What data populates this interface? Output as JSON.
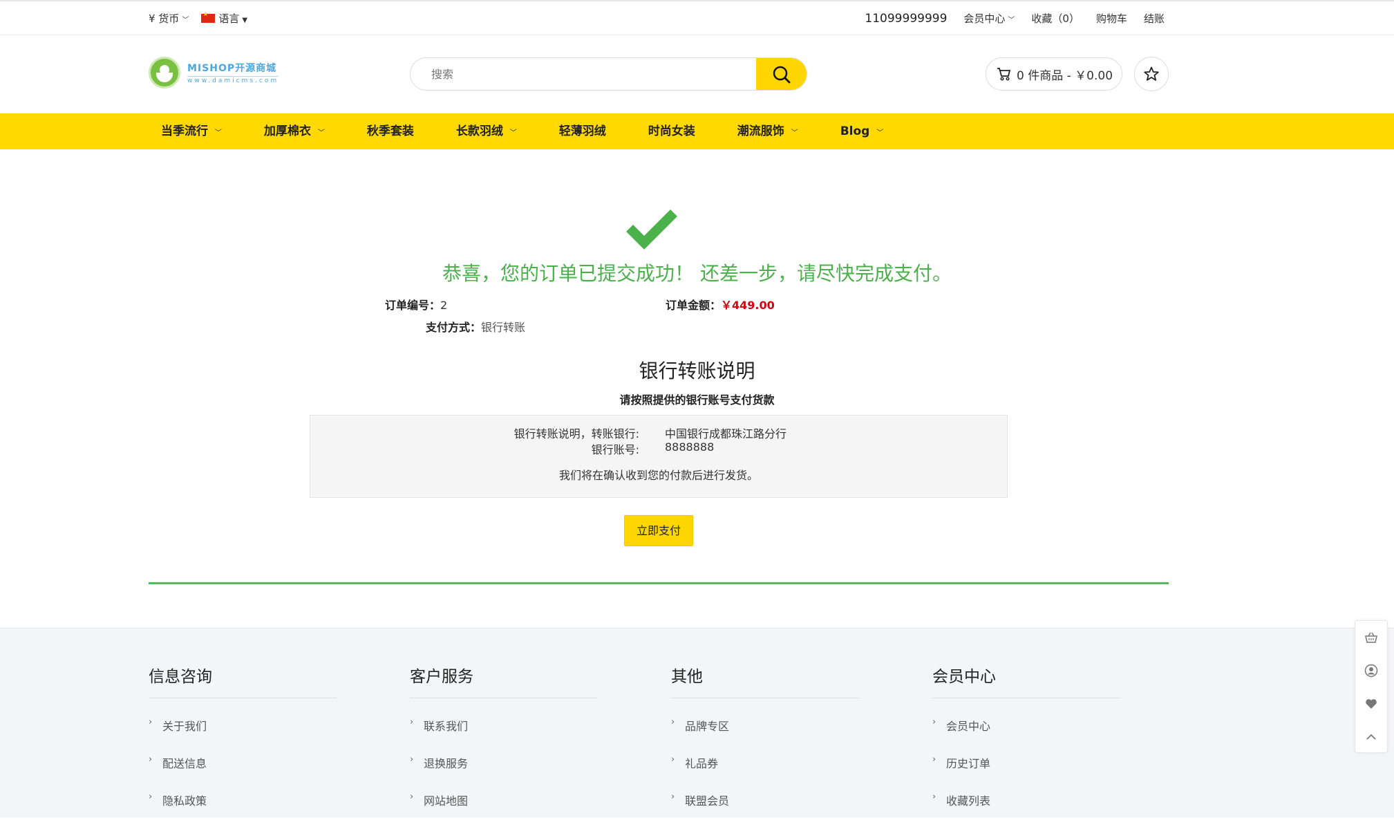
{
  "topbar": {
    "currency_label": "¥ 货币",
    "language_label": "语言",
    "phone": "11099999999",
    "member_center": "会员中心",
    "favorites": "收藏（0）",
    "cart": "购物车",
    "checkout": "结账"
  },
  "header": {
    "logo_line1": "MISHOP开源商城",
    "logo_line2": "www.damicms.com",
    "search_placeholder": "搜索",
    "cart_summary": "0 件商品 - ￥0.00"
  },
  "nav": {
    "items": [
      {
        "label": "当季流行",
        "dropdown": true
      },
      {
        "label": "加厚棉衣",
        "dropdown": true
      },
      {
        "label": "秋季套装",
        "dropdown": false
      },
      {
        "label": "长款羽绒",
        "dropdown": true
      },
      {
        "label": "轻薄羽绒",
        "dropdown": false
      },
      {
        "label": "时尚女装",
        "dropdown": false
      },
      {
        "label": "潮流服饰",
        "dropdown": true
      },
      {
        "label": "Blog",
        "dropdown": true
      }
    ]
  },
  "order": {
    "success_message": "恭喜，您的订单已提交成功！ 还差一步，请尽快完成支付。",
    "order_no_label": "订单编号：",
    "order_no": "2",
    "amount_label": "订单金额：",
    "amount": "￥449.00",
    "pay_method_label": "支付方式：",
    "pay_method": "银行转账"
  },
  "bank": {
    "title": "银行转账说明",
    "subtitle": "请按照提供的银行账号支付货款",
    "line1_label": "银行转账说明，转账银行:",
    "line1_value": "中国银行成都珠江路分行",
    "line2_label": "银行账号:",
    "line2_value": "8888888",
    "note": "我们将在确认收到您的付款后进行发货。",
    "pay_button": "立即支付"
  },
  "footer": {
    "columns": [
      {
        "title": "信息咨询",
        "links": [
          "关于我们",
          "配送信息",
          "隐私政策"
        ]
      },
      {
        "title": "客户服务",
        "links": [
          "联系我们",
          "退换服务",
          "网站地图"
        ]
      },
      {
        "title": "其他",
        "links": [
          "品牌专区",
          "礼品券",
          "联盟会员"
        ]
      },
      {
        "title": "会员中心",
        "links": [
          "会员中心",
          "历史订单",
          "收藏列表"
        ]
      }
    ]
  },
  "colors": {
    "accent_yellow": "#ffd900",
    "success_green": "#4bb14b",
    "price_red": "#d6000f"
  }
}
